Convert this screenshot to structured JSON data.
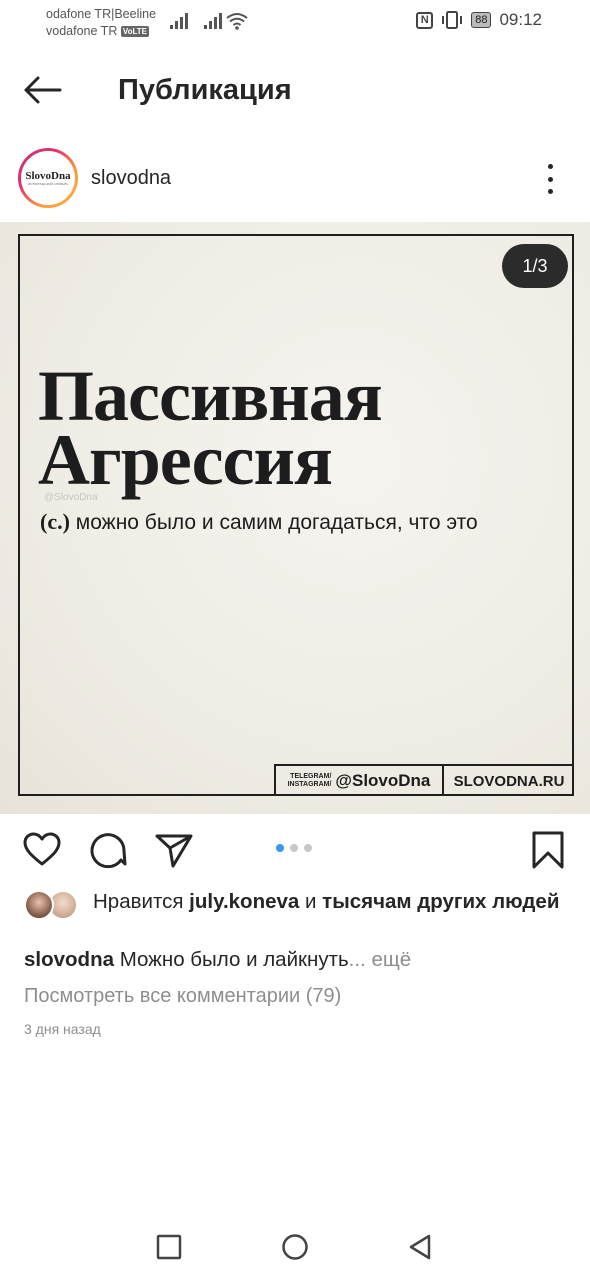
{
  "status_bar": {
    "carrier_1": "odafone TR|Beeline",
    "carrier_2": "vodafone TR",
    "volte": "VoLTE",
    "battery": "88",
    "time": "09:12"
  },
  "header": {
    "title": "Публикация"
  },
  "post": {
    "author": "slovodna",
    "avatar_logo": "SlovoDna",
    "avatar_subtitle": "ИСТОРИЧЕСКИЙ СЛОВАРЬ",
    "counter": "1/3",
    "title_line_1": "Пассивная",
    "title_line_2": "Агрессия",
    "watermark": "@SlovoDna",
    "definition_mark": "(с.)",
    "definition_text": "можно было и самим догадаться, что это",
    "footer_small_1": "TELEGRAM/",
    "footer_small_2": "INSTAGRAM/",
    "footer_handle": "@SlovoDna",
    "footer_site": "SLOVODNA.RU"
  },
  "actions": {
    "carousel_total": 3,
    "carousel_active": 1
  },
  "likes": {
    "prefix": "Нравится",
    "user": "july.koneva",
    "connector": "и",
    "others": "тысячам других людей"
  },
  "caption": {
    "author": "slovodna",
    "text": "Можно было и лайкнуть",
    "ellipsis": "...",
    "more": "ещё"
  },
  "comments": {
    "link": "Посмотреть все комментарии (79)"
  },
  "time_ago": "3 дня назад",
  "colors": {
    "accent": "#3897f0",
    "text": "#262626",
    "muted": "#8e8e8e"
  }
}
